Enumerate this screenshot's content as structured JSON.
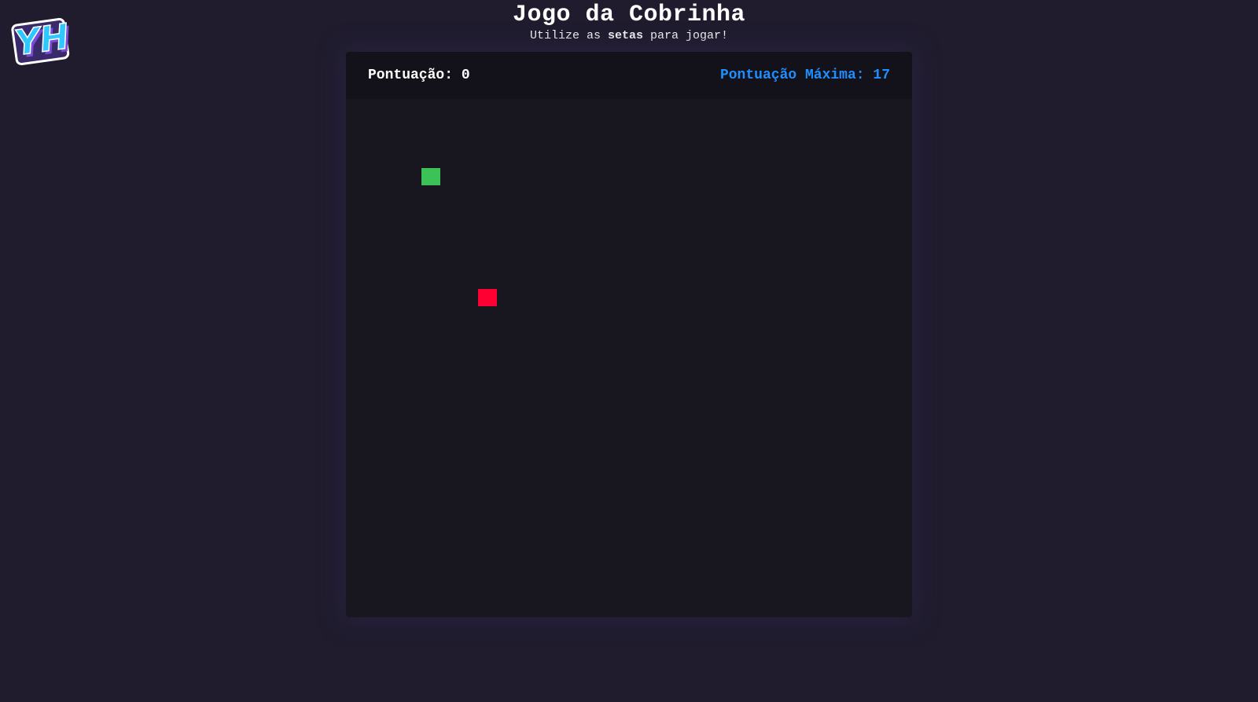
{
  "header": {
    "title": "Jogo da Cobrinha",
    "subtitle_prefix": "Utilize as ",
    "subtitle_bold": "setas",
    "subtitle_suffix": " para jogar!"
  },
  "logo": {
    "text": "YH",
    "colors": {
      "fill": "#2ec8ff",
      "shadow": "#7b4ad9",
      "outline": "#ffffff"
    }
  },
  "scoreboard": {
    "score_label": "Pontuação: ",
    "score_value": "0",
    "high_score_label": "Pontuação Máxima: ",
    "high_score_value": "17"
  },
  "board": {
    "columns": 30,
    "rows": 30,
    "snake": [
      {
        "col": 4,
        "row": 4
      }
    ],
    "food": {
      "col": 7,
      "row": 11
    },
    "colors": {
      "snake": "#3cc257",
      "food": "#ff0033",
      "background": "#18161f",
      "high_score": "#1e8fff"
    }
  }
}
